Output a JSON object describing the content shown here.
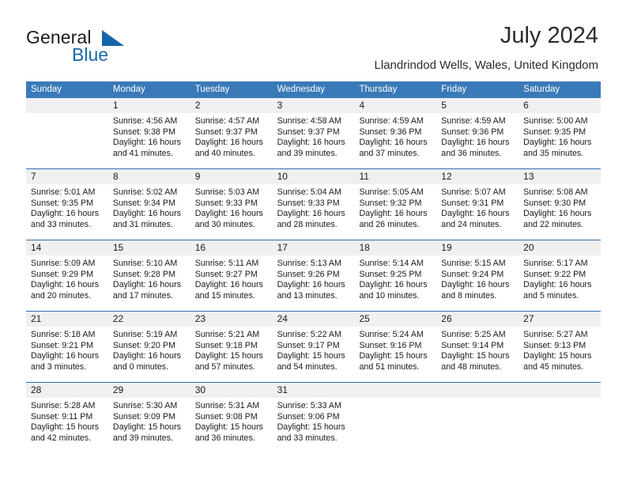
{
  "branding": {
    "name_part1": "General",
    "name_part2": "Blue",
    "accent_color": "#1668ad"
  },
  "header": {
    "title": "July 2024",
    "subtitle": "Llandrindod Wells, Wales, United Kingdom"
  },
  "calendar": {
    "header_bg": "#3a79b8",
    "daynum_bg": "#f0f0f0",
    "divider_color": "#2f6daf",
    "weekdays": [
      "Sunday",
      "Monday",
      "Tuesday",
      "Wednesday",
      "Thursday",
      "Friday",
      "Saturday"
    ],
    "weeks": [
      {
        "days": [
          {
            "num": "",
            "lines": [
              "",
              "",
              "",
              ""
            ]
          },
          {
            "num": "1",
            "lines": [
              "Sunrise: 4:56 AM",
              "Sunset: 9:38 PM",
              "Daylight: 16 hours",
              "and 41 minutes."
            ]
          },
          {
            "num": "2",
            "lines": [
              "Sunrise: 4:57 AM",
              "Sunset: 9:37 PM",
              "Daylight: 16 hours",
              "and 40 minutes."
            ]
          },
          {
            "num": "3",
            "lines": [
              "Sunrise: 4:58 AM",
              "Sunset: 9:37 PM",
              "Daylight: 16 hours",
              "and 39 minutes."
            ]
          },
          {
            "num": "4",
            "lines": [
              "Sunrise: 4:59 AM",
              "Sunset: 9:36 PM",
              "Daylight: 16 hours",
              "and 37 minutes."
            ]
          },
          {
            "num": "5",
            "lines": [
              "Sunrise: 4:59 AM",
              "Sunset: 9:36 PM",
              "Daylight: 16 hours",
              "and 36 minutes."
            ]
          },
          {
            "num": "6",
            "lines": [
              "Sunrise: 5:00 AM",
              "Sunset: 9:35 PM",
              "Daylight: 16 hours",
              "and 35 minutes."
            ]
          }
        ]
      },
      {
        "days": [
          {
            "num": "7",
            "lines": [
              "Sunrise: 5:01 AM",
              "Sunset: 9:35 PM",
              "Daylight: 16 hours",
              "and 33 minutes."
            ]
          },
          {
            "num": "8",
            "lines": [
              "Sunrise: 5:02 AM",
              "Sunset: 9:34 PM",
              "Daylight: 16 hours",
              "and 31 minutes."
            ]
          },
          {
            "num": "9",
            "lines": [
              "Sunrise: 5:03 AM",
              "Sunset: 9:33 PM",
              "Daylight: 16 hours",
              "and 30 minutes."
            ]
          },
          {
            "num": "10",
            "lines": [
              "Sunrise: 5:04 AM",
              "Sunset: 9:33 PM",
              "Daylight: 16 hours",
              "and 28 minutes."
            ]
          },
          {
            "num": "11",
            "lines": [
              "Sunrise: 5:05 AM",
              "Sunset: 9:32 PM",
              "Daylight: 16 hours",
              "and 26 minutes."
            ]
          },
          {
            "num": "12",
            "lines": [
              "Sunrise: 5:07 AM",
              "Sunset: 9:31 PM",
              "Daylight: 16 hours",
              "and 24 minutes."
            ]
          },
          {
            "num": "13",
            "lines": [
              "Sunrise: 5:08 AM",
              "Sunset: 9:30 PM",
              "Daylight: 16 hours",
              "and 22 minutes."
            ]
          }
        ]
      },
      {
        "days": [
          {
            "num": "14",
            "lines": [
              "Sunrise: 5:09 AM",
              "Sunset: 9:29 PM",
              "Daylight: 16 hours",
              "and 20 minutes."
            ]
          },
          {
            "num": "15",
            "lines": [
              "Sunrise: 5:10 AM",
              "Sunset: 9:28 PM",
              "Daylight: 16 hours",
              "and 17 minutes."
            ]
          },
          {
            "num": "16",
            "lines": [
              "Sunrise: 5:11 AM",
              "Sunset: 9:27 PM",
              "Daylight: 16 hours",
              "and 15 minutes."
            ]
          },
          {
            "num": "17",
            "lines": [
              "Sunrise: 5:13 AM",
              "Sunset: 9:26 PM",
              "Daylight: 16 hours",
              "and 13 minutes."
            ]
          },
          {
            "num": "18",
            "lines": [
              "Sunrise: 5:14 AM",
              "Sunset: 9:25 PM",
              "Daylight: 16 hours",
              "and 10 minutes."
            ]
          },
          {
            "num": "19",
            "lines": [
              "Sunrise: 5:15 AM",
              "Sunset: 9:24 PM",
              "Daylight: 16 hours",
              "and 8 minutes."
            ]
          },
          {
            "num": "20",
            "lines": [
              "Sunrise: 5:17 AM",
              "Sunset: 9:22 PM",
              "Daylight: 16 hours",
              "and 5 minutes."
            ]
          }
        ]
      },
      {
        "days": [
          {
            "num": "21",
            "lines": [
              "Sunrise: 5:18 AM",
              "Sunset: 9:21 PM",
              "Daylight: 16 hours",
              "and 3 minutes."
            ]
          },
          {
            "num": "22",
            "lines": [
              "Sunrise: 5:19 AM",
              "Sunset: 9:20 PM",
              "Daylight: 16 hours",
              "and 0 minutes."
            ]
          },
          {
            "num": "23",
            "lines": [
              "Sunrise: 5:21 AM",
              "Sunset: 9:18 PM",
              "Daylight: 15 hours",
              "and 57 minutes."
            ]
          },
          {
            "num": "24",
            "lines": [
              "Sunrise: 5:22 AM",
              "Sunset: 9:17 PM",
              "Daylight: 15 hours",
              "and 54 minutes."
            ]
          },
          {
            "num": "25",
            "lines": [
              "Sunrise: 5:24 AM",
              "Sunset: 9:16 PM",
              "Daylight: 15 hours",
              "and 51 minutes."
            ]
          },
          {
            "num": "26",
            "lines": [
              "Sunrise: 5:25 AM",
              "Sunset: 9:14 PM",
              "Daylight: 15 hours",
              "and 48 minutes."
            ]
          },
          {
            "num": "27",
            "lines": [
              "Sunrise: 5:27 AM",
              "Sunset: 9:13 PM",
              "Daylight: 15 hours",
              "and 45 minutes."
            ]
          }
        ]
      },
      {
        "days": [
          {
            "num": "28",
            "lines": [
              "Sunrise: 5:28 AM",
              "Sunset: 9:11 PM",
              "Daylight: 15 hours",
              "and 42 minutes."
            ]
          },
          {
            "num": "29",
            "lines": [
              "Sunrise: 5:30 AM",
              "Sunset: 9:09 PM",
              "Daylight: 15 hours",
              "and 39 minutes."
            ]
          },
          {
            "num": "30",
            "lines": [
              "Sunrise: 5:31 AM",
              "Sunset: 9:08 PM",
              "Daylight: 15 hours",
              "and 36 minutes."
            ]
          },
          {
            "num": "31",
            "lines": [
              "Sunrise: 5:33 AM",
              "Sunset: 9:06 PM",
              "Daylight: 15 hours",
              "and 33 minutes."
            ]
          },
          {
            "num": "",
            "lines": [
              "",
              "",
              "",
              ""
            ]
          },
          {
            "num": "",
            "lines": [
              "",
              "",
              "",
              ""
            ]
          },
          {
            "num": "",
            "lines": [
              "",
              "",
              "",
              ""
            ]
          }
        ]
      }
    ]
  }
}
